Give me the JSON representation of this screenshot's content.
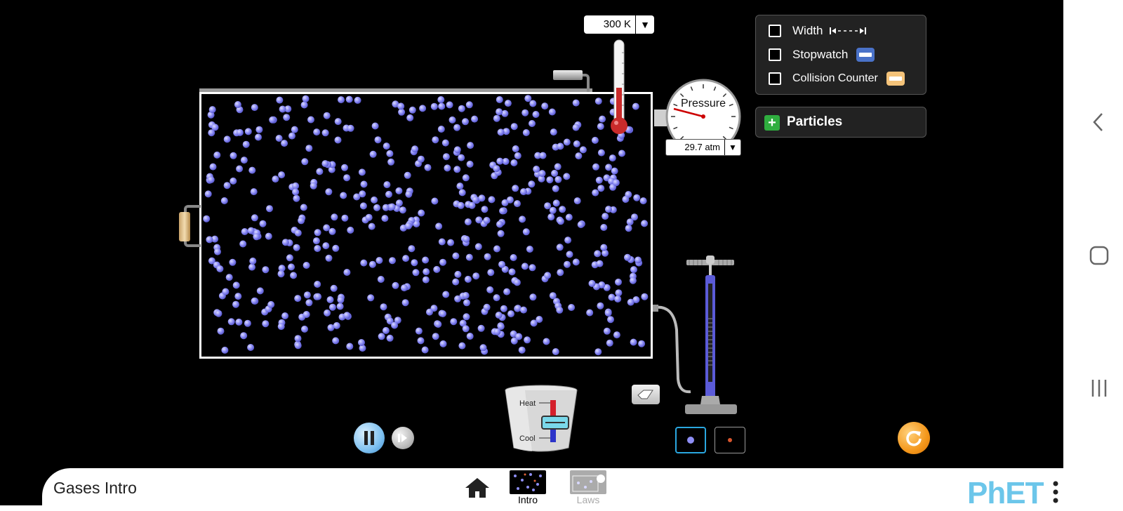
{
  "app": {
    "title": "Gases Intro"
  },
  "thermometer": {
    "value": "300 K"
  },
  "pressure_gauge": {
    "label": "Pressure",
    "value": "29.7 atm"
  },
  "options": [
    {
      "label": "Width",
      "checked": false,
      "icon": "width-arrows-icon"
    },
    {
      "label": "Stopwatch",
      "checked": false,
      "icon": "stopwatch-icon"
    },
    {
      "label": "Collision Counter",
      "checked": false,
      "icon": "collision-counter-icon"
    }
  ],
  "particles_panel": {
    "label": "Particles",
    "expanded": false
  },
  "bucket": {
    "heat_label": "Heat",
    "cool_label": "Cool"
  },
  "screens": [
    {
      "label": "Intro",
      "selected": true
    },
    {
      "label": "Laws",
      "selected": false
    }
  ],
  "brand": {
    "logo": "PhET"
  },
  "colors": {
    "particle": "#8e8ef5",
    "accent_play": "#7fc1f0",
    "reset": "#f4971b",
    "brand": "#6cc6ea"
  }
}
